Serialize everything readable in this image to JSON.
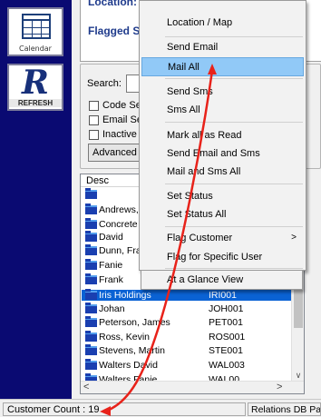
{
  "sidebar": {
    "calendar_label": "Calendar",
    "refresh_letter": "R",
    "refresh_label": "REFRESH"
  },
  "top": {
    "location_label": "Location:",
    "flagged_label": "Flagged S"
  },
  "search": {
    "label": "Search:",
    "options": [
      "Code Se",
      "Email Se",
      "Inactive"
    ],
    "advanced_label": "Advanced"
  },
  "list": {
    "header_desc": "Desc",
    "rows": [
      {
        "name": "",
        "code": ""
      },
      {
        "name": "Andrews,",
        "code": ""
      },
      {
        "name": "Concrete",
        "code": ""
      },
      {
        "name": "David",
        "code": ""
      },
      {
        "name": "Dunn, Fra",
        "code": ""
      },
      {
        "name": "Fanie",
        "code": ""
      },
      {
        "name": "Frank",
        "code": ""
      },
      {
        "name": "Iris Holdings",
        "code": "IRI001"
      },
      {
        "name": "Johan",
        "code": "JOH001"
      },
      {
        "name": "Peterson, James",
        "code": "PET001"
      },
      {
        "name": "Ross, Kevin",
        "code": "ROS001"
      },
      {
        "name": "Stevens, Martin",
        "code": "STE001"
      },
      {
        "name": "Walters David",
        "code": "WAL003"
      },
      {
        "name": "Walters Fanie",
        "code": "WAL00"
      }
    ],
    "selected_index": 7
  },
  "status": {
    "customer_count": "Customer Count : 19",
    "db_path": "Relations DB Path"
  },
  "context_menu": {
    "items": [
      "Location / Map",
      "Send Email",
      "Mail All",
      "Send Sms",
      "Sms All",
      "Mark all as Read",
      "Send Email and Sms",
      "Mail and Sms All",
      "Set Status",
      "Set Status All",
      "Flag Customer",
      "Flag for Specific User",
      "At a Glance View"
    ],
    "highlighted": "Mail All",
    "submenu_item": "Flag Customer"
  },
  "colors": {
    "sidebar": "#0a0a72",
    "selection": "#0a62d4",
    "menu_highlight": "#91c9f7",
    "annotation": "#e8221a"
  },
  "icons": [
    "calendar-icon",
    "refresh-icon",
    "folder-icon",
    "chevron-right-icon",
    "scroll-arrow-icon"
  ]
}
